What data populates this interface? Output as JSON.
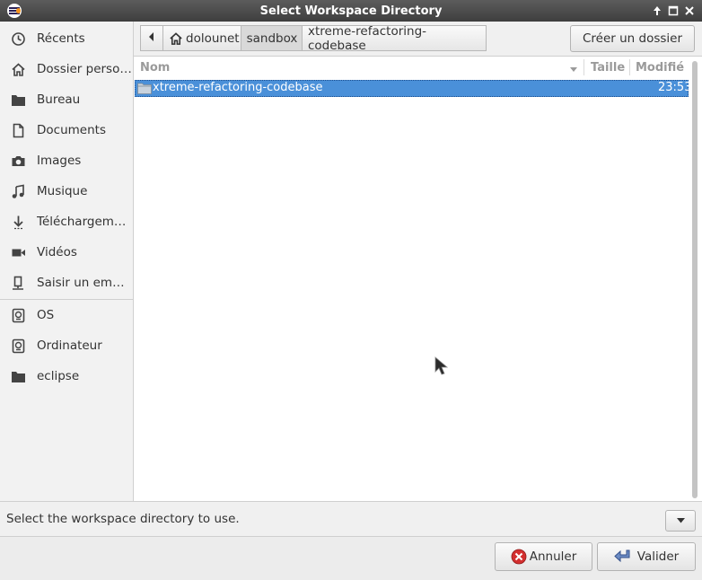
{
  "window": {
    "title": "Select Workspace Directory"
  },
  "sidebar": {
    "items": [
      {
        "label": "Récents",
        "icon": "clock-icon"
      },
      {
        "label": "Dossier personnel",
        "icon": "home-icon"
      },
      {
        "label": "Bureau",
        "icon": "folder-icon"
      },
      {
        "label": "Documents",
        "icon": "document-icon"
      },
      {
        "label": "Images",
        "icon": "camera-icon"
      },
      {
        "label": "Musique",
        "icon": "music-icon"
      },
      {
        "label": "Téléchargements",
        "icon": "download-icon"
      },
      {
        "label": "Vidéos",
        "icon": "video-icon"
      },
      {
        "label": "Saisir un emplacement",
        "icon": "network-icon"
      },
      {
        "label": "OS",
        "icon": "drive-icon"
      },
      {
        "label": "Ordinateur",
        "icon": "drive-icon"
      },
      {
        "label": "eclipse",
        "icon": "folder-icon"
      }
    ]
  },
  "pathbar": {
    "segments": [
      "dolounet",
      "sandbox",
      "xtreme-refactoring-codebase"
    ]
  },
  "toolbar": {
    "create_folder_label": "Créer un dossier"
  },
  "filelist": {
    "columns": {
      "name": "Nom",
      "size": "Taille",
      "modified": "Modifié"
    },
    "rows": [
      {
        "name": "xtreme-refactoring-codebase",
        "size": "",
        "modified": "23:53",
        "selected": true
      }
    ]
  },
  "status": {
    "message": "Select the workspace directory to use."
  },
  "actions": {
    "cancel_label": "Annuler",
    "ok_label": "Valider"
  },
  "colors": {
    "selection": "#4a90d9",
    "titlebar": "#4a4a4a"
  }
}
